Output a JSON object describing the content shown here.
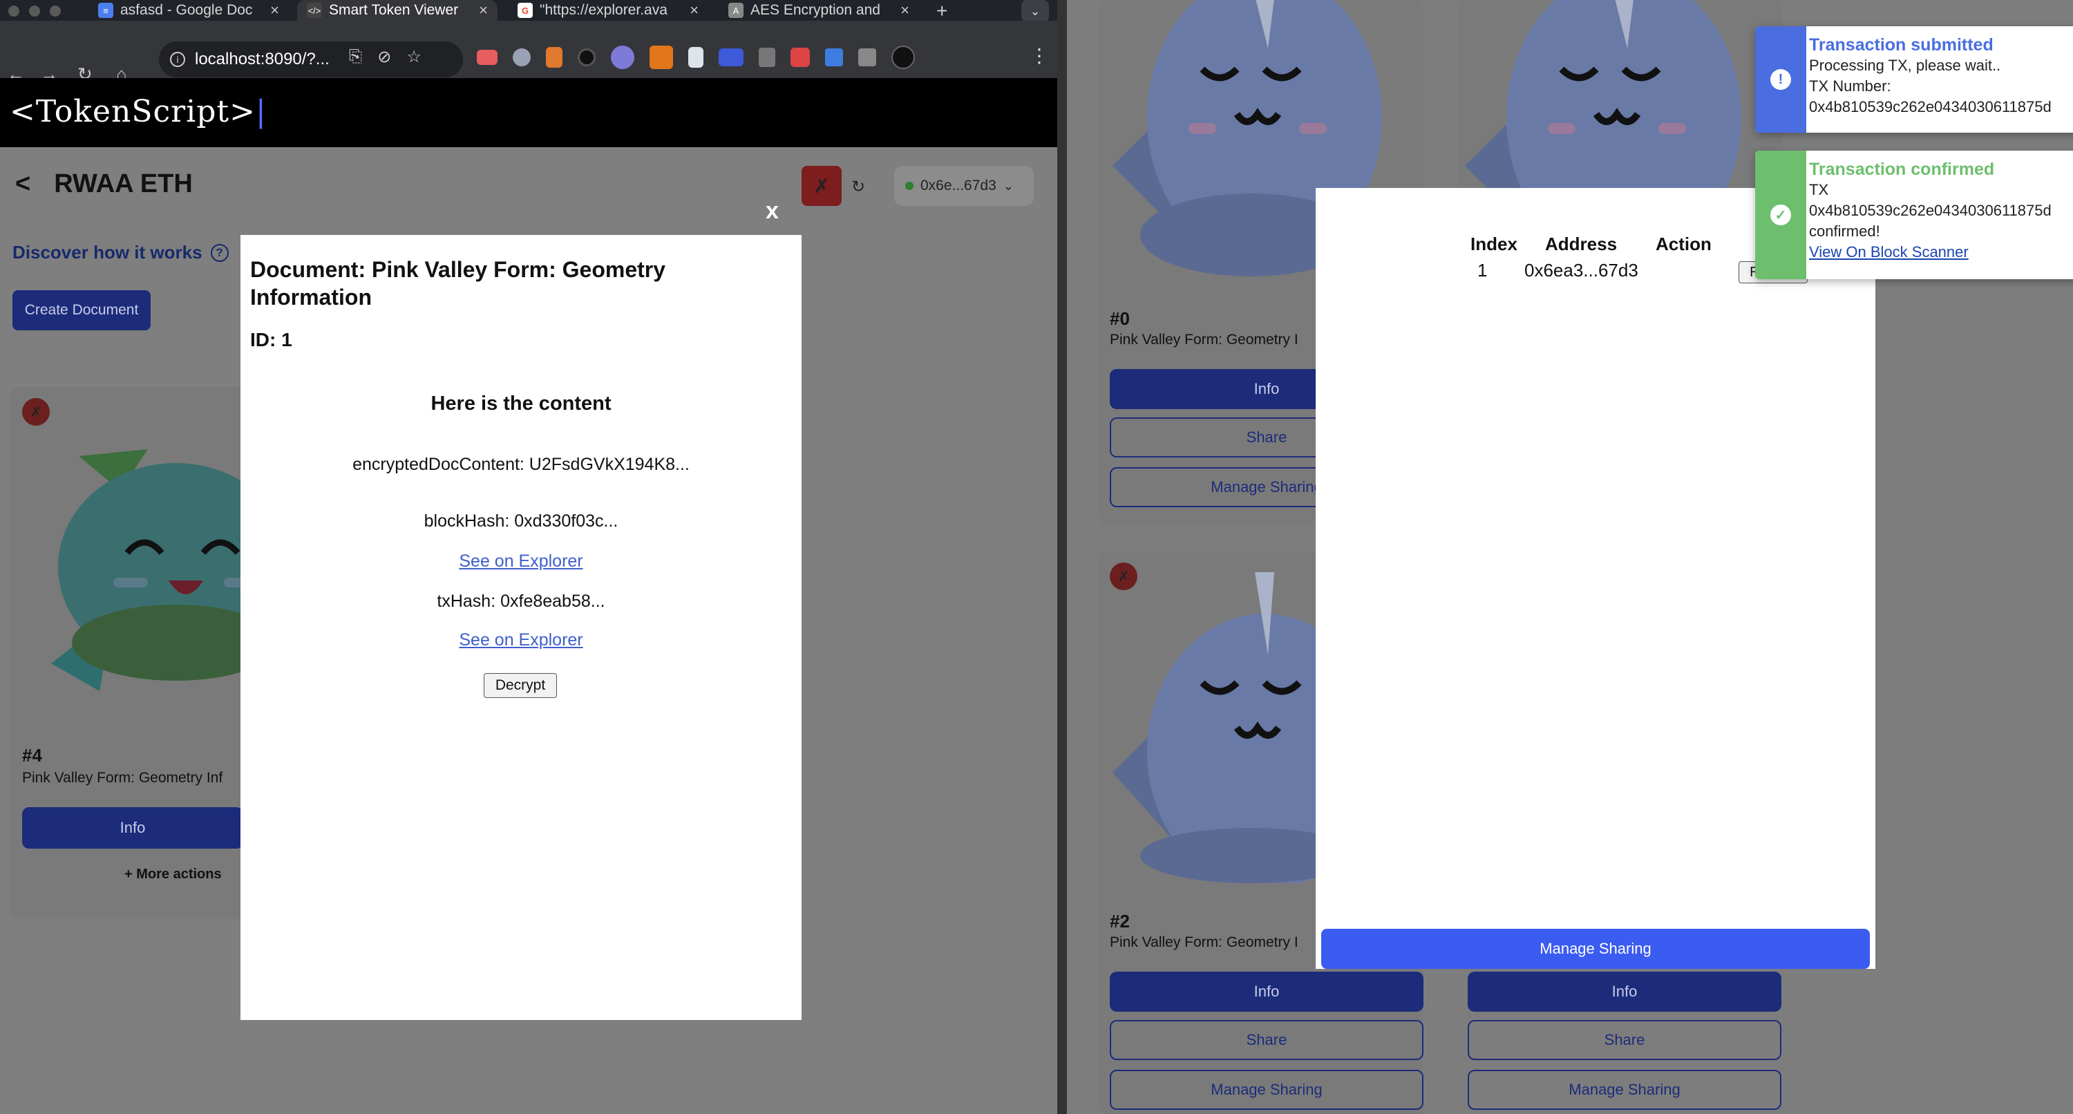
{
  "browser": {
    "tabs": [
      {
        "label": "asfasd - Google Doc",
        "icon": "docs-icon",
        "color": "#4b7ef0"
      },
      {
        "label": "Smart Token Viewer",
        "icon": "code-icon",
        "color": "#444"
      },
      {
        "label": "\"https://explorer.ava",
        "icon": "google-icon",
        "color": "#ea4335"
      },
      {
        "label": "AES Encryption and",
        "icon": "aes-icon",
        "color": "#888"
      }
    ],
    "url": "localhost:8090/?..."
  },
  "app": {
    "logo_left": "<TokenScript>",
    "logo_cursor": "|",
    "back": "<",
    "title": "RWAA ETH",
    "status_x": "✗",
    "refresh": "↻",
    "wallet": "0x6e...67d3",
    "discover": "Discover how it works",
    "discover_icon": "?",
    "create_document": "Create Document"
  },
  "left_card": {
    "x": "✗",
    "number": "#4",
    "name": "Pink Valley Form: Geometry Inf",
    "info": "Info",
    "more_actions": "+ More actions"
  },
  "document_modal": {
    "close": "x",
    "title": "Document: Pink Valley Form: Geometry Information",
    "id": "ID: 1",
    "subtitle": "Here is the content",
    "encrypted": "encryptedDocContent: U2FsdGVkX194K8...",
    "block_hash": "blockHash: 0xd330f03c...",
    "see_explorer_1": "See on Explorer",
    "tx_hash": "txHash: 0xfe8eab58...",
    "see_explorer_2": "See on Explorer",
    "decrypt": "Decrypt"
  },
  "right_cards": {
    "card0": {
      "number": "#0",
      "name": "Pink Valley Form: Geometry I",
      "info": "Info",
      "share": "Share",
      "manage": "Manage Sharing"
    },
    "card2": {
      "x": "✗",
      "number": "#2",
      "name": "Pink Valley Form: Geometry I",
      "info": "Info",
      "share": "Share",
      "manage": "Manage Sharing"
    },
    "card3": {
      "info": "Info",
      "share": "Share",
      "manage": "Manage Sharing"
    }
  },
  "sharing_modal": {
    "headers": [
      "Index",
      "Address",
      "Action"
    ],
    "row": {
      "index": "1",
      "address": "0x6ea3...67d3",
      "action": "Revoke"
    },
    "manage_button": "Manage Sharing"
  },
  "toasts": {
    "submitted": {
      "title": "Transaction submitted",
      "line1": "Processing TX, please wait..",
      "line2": "TX Number:",
      "line3": "0x4b810539c262e0434030611875d",
      "icon": "!",
      "color": "#4a6ee0"
    },
    "confirmed": {
      "title": "Transaction confirmed",
      "line1": "TX",
      "line2": "0x4b810539c262e0434030611875d",
      "line3": "confirmed!",
      "link": "View On Block Scanner",
      "icon": "✓",
      "color": "#6dbf6d"
    }
  }
}
